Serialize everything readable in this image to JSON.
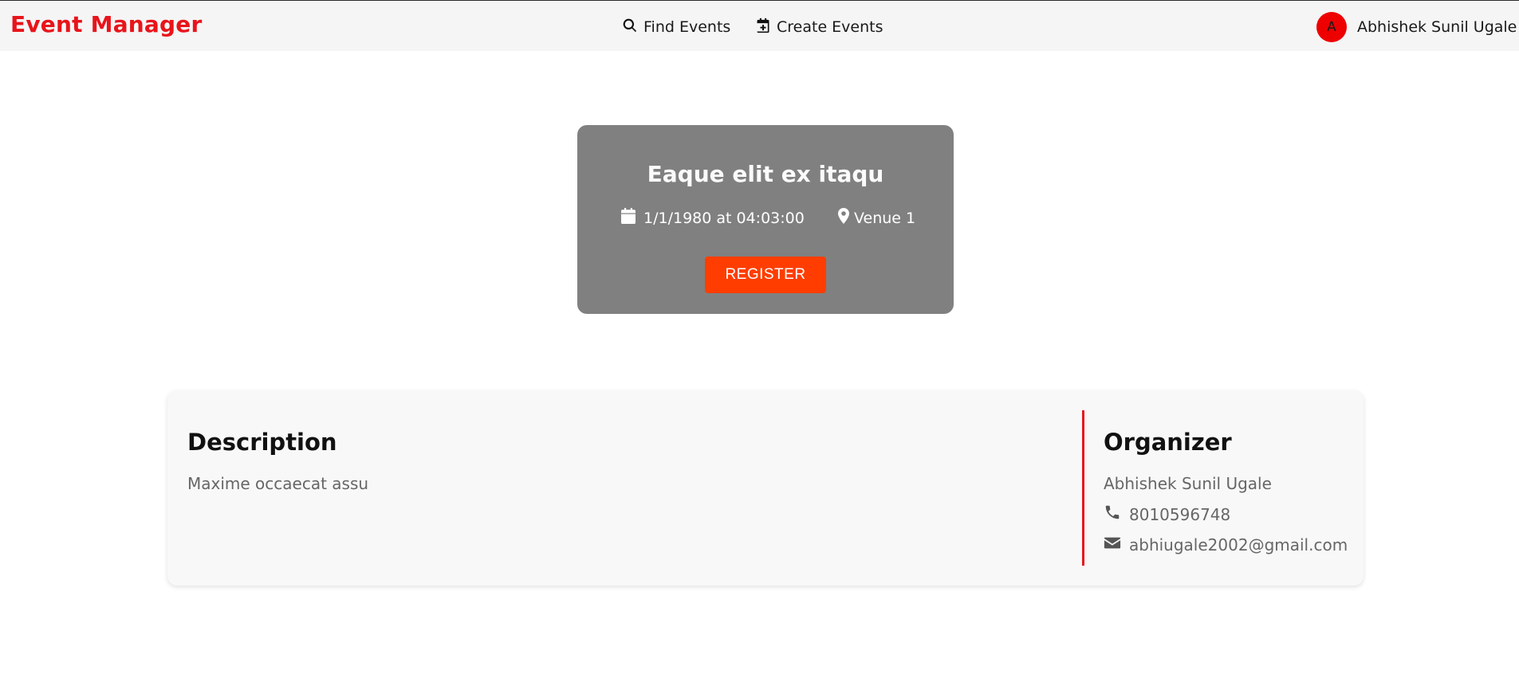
{
  "navbar": {
    "brand": "Event Manager",
    "links": [
      {
        "label": "Find Events",
        "icon": "search-icon"
      },
      {
        "label": "Create Events",
        "icon": "calendar-plus-icon"
      }
    ],
    "user": {
      "avatar_letter": "A",
      "name": "Abhishek Sunil Ugale"
    }
  },
  "event": {
    "title": "Eaque elit ex itaqu",
    "datetime": "1/1/1980 at 04:03:00",
    "venue": "Venue 1",
    "register_label": "REGISTER"
  },
  "details": {
    "description_heading": "Description",
    "description_text": "Maxime occaecat assu",
    "organizer_heading": "Organizer",
    "organizer_name": "Abhishek Sunil Ugale",
    "organizer_phone": "8010596748",
    "organizer_email": "abhiugale2002@gmail.com"
  },
  "colors": {
    "brand": "#e8141b",
    "register_button": "#ff3d00",
    "event_card": "#808080",
    "avatar": "#ee0000"
  }
}
